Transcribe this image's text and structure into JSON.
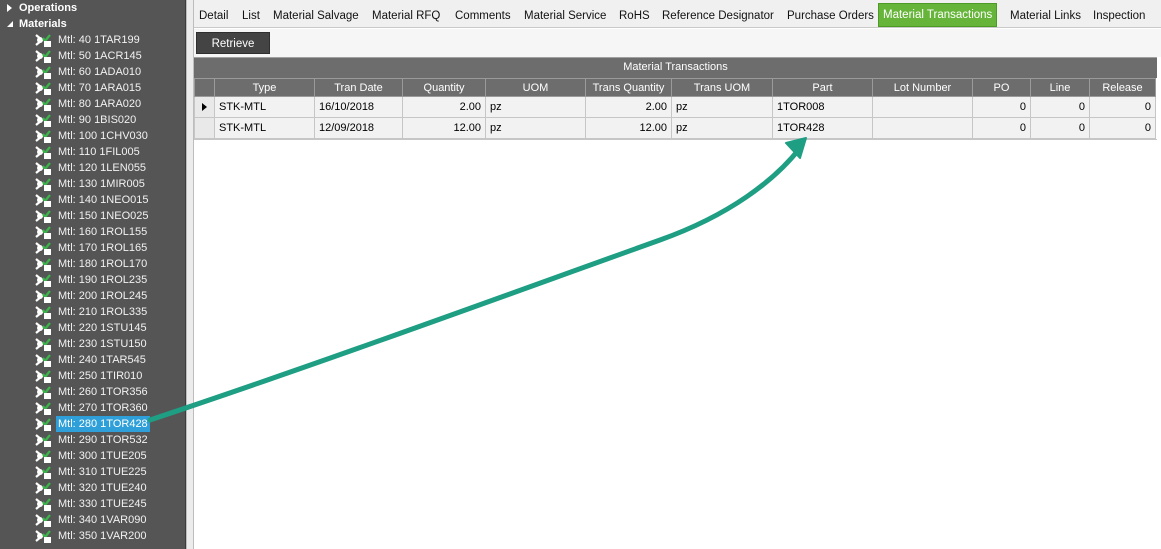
{
  "tree": {
    "groups": [
      {
        "label": "Operations",
        "expanded": false
      },
      {
        "label": "Materials",
        "expanded": true
      }
    ],
    "items": [
      {
        "label": "Mtl: 40 1TAR199",
        "icon": "material-ok-icon"
      },
      {
        "label": "Mtl: 50 1ACR145",
        "icon": "material-ok-icon"
      },
      {
        "label": "Mtl: 60 1ADA010",
        "icon": "material-ok-icon"
      },
      {
        "label": "Mtl: 70 1ARA015",
        "icon": "material-ok-icon"
      },
      {
        "label": "Mtl: 80 1ARA020",
        "icon": "material-ok-icon"
      },
      {
        "label": "Mtl: 90 1BIS020",
        "icon": "material-ok-icon"
      },
      {
        "label": "Mtl: 100 1CHV030",
        "icon": "material-ok-icon"
      },
      {
        "label": "Mtl: 110 1FIL005",
        "icon": "material-ok-icon"
      },
      {
        "label": "Mtl: 120 1LEN055",
        "icon": "material-ok-icon"
      },
      {
        "label": "Mtl: 130 1MIR005",
        "icon": "material-ok-icon"
      },
      {
        "label": "Mtl: 140 1NEO015",
        "icon": "material-ok-icon"
      },
      {
        "label": "Mtl: 150 1NEO025",
        "icon": "material-ok-icon"
      },
      {
        "label": "Mtl: 160 1ROL155",
        "icon": "material-ok-icon"
      },
      {
        "label": "Mtl: 170 1ROL165",
        "icon": "material-ok-icon"
      },
      {
        "label": "Mtl: 180 1ROL170",
        "icon": "material-ok-icon"
      },
      {
        "label": "Mtl: 190 1ROL235",
        "icon": "material-ok-icon"
      },
      {
        "label": "Mtl: 200 1ROL245",
        "icon": "material-ok-icon"
      },
      {
        "label": "Mtl: 210 1ROL335",
        "icon": "material-ok-icon"
      },
      {
        "label": "Mtl: 220 1STU145",
        "icon": "material-ok-icon"
      },
      {
        "label": "Mtl: 230 1STU150",
        "icon": "material-ok-icon"
      },
      {
        "label": "Mtl: 240 1TAR545",
        "icon": "material-ok-icon"
      },
      {
        "label": "Mtl: 250 1TIR010",
        "icon": "material-ok-icon"
      },
      {
        "label": "Mtl: 260 1TOR356",
        "icon": "material-ok-icon"
      },
      {
        "label": "Mtl: 270 1TOR360",
        "icon": "material-ok-icon"
      },
      {
        "label": "Mtl: 280 1TOR428",
        "icon": "material-ok-icon",
        "selected": true
      },
      {
        "label": "Mtl: 290 1TOR532",
        "icon": "material-ok-icon"
      },
      {
        "label": "Mtl: 300 1TUE205",
        "icon": "material-ok-icon"
      },
      {
        "label": "Mtl: 310 1TUE225",
        "icon": "material-ok-icon"
      },
      {
        "label": "Mtl: 320 1TUE240",
        "icon": "material-ok-icon"
      },
      {
        "label": "Mtl: 330 1TUE245",
        "icon": "material-ok-icon"
      },
      {
        "label": "Mtl: 340 1VAR090",
        "icon": "material-ok-icon"
      },
      {
        "label": "Mtl: 350 1VAR200",
        "icon": "material-ok-icon"
      }
    ]
  },
  "tabs": [
    {
      "label": "Detail"
    },
    {
      "label": "List"
    },
    {
      "label": "Material Salvage"
    },
    {
      "label": "Material RFQ"
    },
    {
      "label": "Comments"
    },
    {
      "label": "Material Service"
    },
    {
      "label": "RoHS"
    },
    {
      "label": "Reference Designator"
    },
    {
      "label": "Purchase Orders"
    },
    {
      "label": "Material Transactions",
      "active": true
    },
    {
      "label": "Material Links"
    },
    {
      "label": "Inspection"
    }
  ],
  "toolbar": {
    "retrieve_label": "Retrieve"
  },
  "grid": {
    "caption": "Material Transactions",
    "columns": [
      "Type",
      "Tran Date",
      "Quantity",
      "UOM",
      "Trans Quantity",
      "Trans UOM",
      "Part",
      "Lot Number",
      "PO",
      "Line",
      "Release"
    ],
    "rows": [
      [
        "STK-MTL",
        "16/10/2018",
        "2.00",
        "pz",
        "2.00",
        "pz",
        "1TOR008",
        "",
        "0",
        "0",
        "0"
      ],
      [
        "STK-MTL",
        "12/09/2018",
        "12.00",
        "pz",
        "12.00",
        "pz",
        "1TOR428",
        "",
        "0",
        "0",
        "0"
      ]
    ],
    "current_row": 0
  },
  "colors": {
    "tree_bg": "#555555",
    "selected_item": "#2e9fd8",
    "active_tab": "#66b53a",
    "header_bg": "#6d6d6d",
    "annotation_arrow": "#1e9e83"
  }
}
